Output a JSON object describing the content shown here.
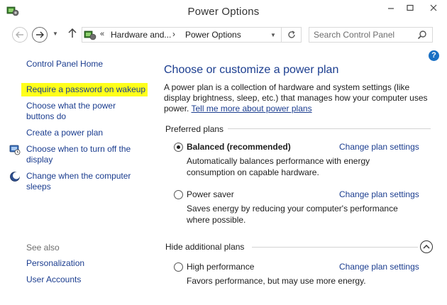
{
  "window": {
    "title": "Power Options",
    "controls": {
      "minimize": "–",
      "maximize": "□",
      "close": "✕"
    }
  },
  "nav": {
    "back_icon": "back-arrow",
    "forward_icon": "forward-arrow",
    "up_icon": "up-arrow",
    "chevron": "«",
    "breadcrumbs": [
      "Hardware and...",
      "Power Options"
    ],
    "separator": "›",
    "search_placeholder": "Search Control Panel"
  },
  "sidebar": {
    "home": "Control Panel Home",
    "items": [
      {
        "label": "Require a password on wakeup",
        "highlighted": true
      },
      {
        "label": "Choose what the power buttons do"
      },
      {
        "label": "Create a power plan"
      },
      {
        "label": "Choose when to turn off the display",
        "icon": "display-clock-icon"
      },
      {
        "label": "Change when the computer sleeps",
        "icon": "moon-sleep-icon"
      }
    ],
    "see_also_heading": "See also",
    "see_also": [
      "Personalization",
      "User Accounts"
    ]
  },
  "main": {
    "heading": "Choose or customize a power plan",
    "intro": "A power plan is a collection of hardware and system settings (like display brightness, sleep, etc.) that manages how your computer uses power.",
    "intro_link": "Tell me more about power plans",
    "preferred_title": "Preferred plans",
    "hidden_title": "Hide additional plans",
    "change_label": "Change plan settings",
    "plans": [
      {
        "name": "Balanced (recommended)",
        "selected": true,
        "description": "Automatically balances performance with energy consumption on capable hardware."
      },
      {
        "name": "Power saver",
        "selected": false,
        "description": "Saves energy by reducing your computer's performance where possible."
      },
      {
        "name": "High performance",
        "selected": false,
        "description": "Favors performance, but may use more energy."
      }
    ]
  },
  "colors": {
    "link": "#1b3d8f",
    "highlight": "#ffff1a",
    "help": "#1a70c4"
  }
}
